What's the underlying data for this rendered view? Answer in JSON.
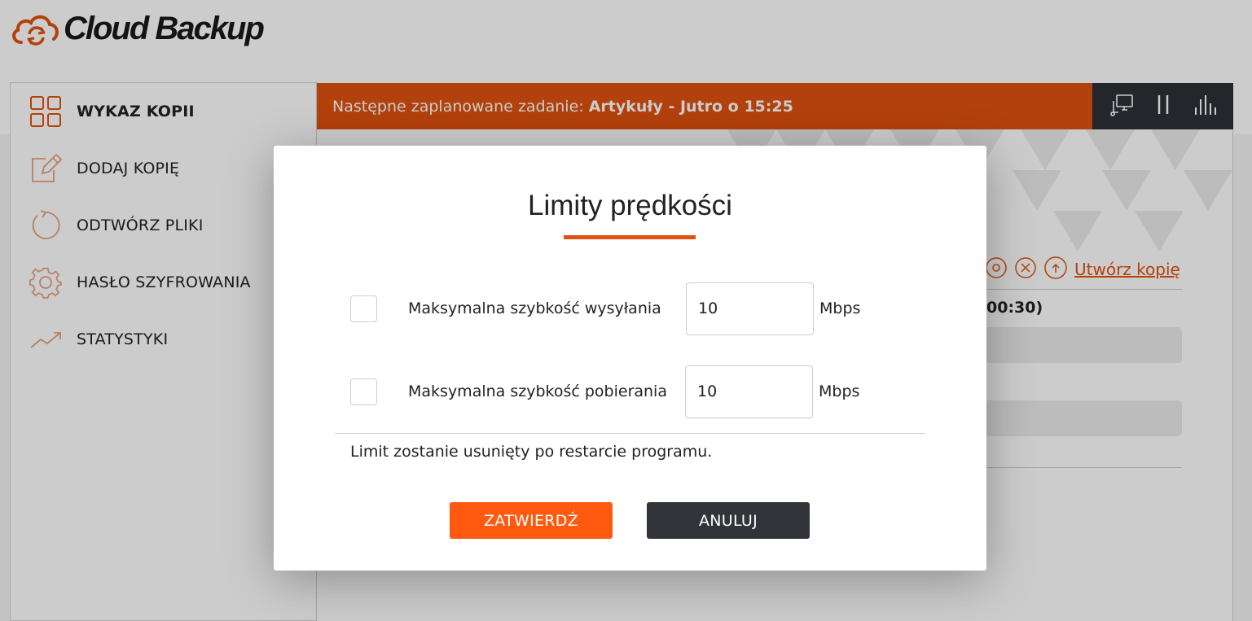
{
  "app": {
    "logo_text": "Cloud Backup",
    "accent_color": "#e0520f",
    "dark_color": "#2c3136"
  },
  "sidebar": {
    "items": [
      {
        "label": "WYKAZ KOPII",
        "icon": "grid-icon",
        "active": true
      },
      {
        "label": "DODAJ KOPIĘ",
        "icon": "edit-icon",
        "active": false
      },
      {
        "label": "ODTWÓRZ PLIKI",
        "icon": "restore-icon",
        "active": false
      },
      {
        "label": "HASŁO SZYFROWANIA",
        "icon": "gear-icon",
        "active": false
      },
      {
        "label": "STATYSTYKI",
        "icon": "trend-icon",
        "active": false
      }
    ]
  },
  "banner": {
    "prefix": "Następne zaplanowane zadanie:",
    "task": "Artykuły - Jutro o 15:25"
  },
  "toolbar": {
    "icons": [
      "monitor-icon",
      "pause-icon",
      "stats-icon"
    ]
  },
  "background": {
    "create_backup_link": "Utwórz kopię",
    "time_fragment": "00:30)"
  },
  "modal": {
    "title": "Limity prędkości",
    "upload": {
      "label": "Maksymalna szybkość wysyłania",
      "value": "10",
      "unit": "Mbps",
      "checked": false
    },
    "download": {
      "label": "Maksymalna szybkość pobierania",
      "value": "10",
      "unit": "Mbps",
      "checked": false
    },
    "note": "Limit zostanie usunięty po restarcie programu.",
    "confirm_label": "ZATWIERDŹ",
    "cancel_label": "ANULUJ"
  }
}
